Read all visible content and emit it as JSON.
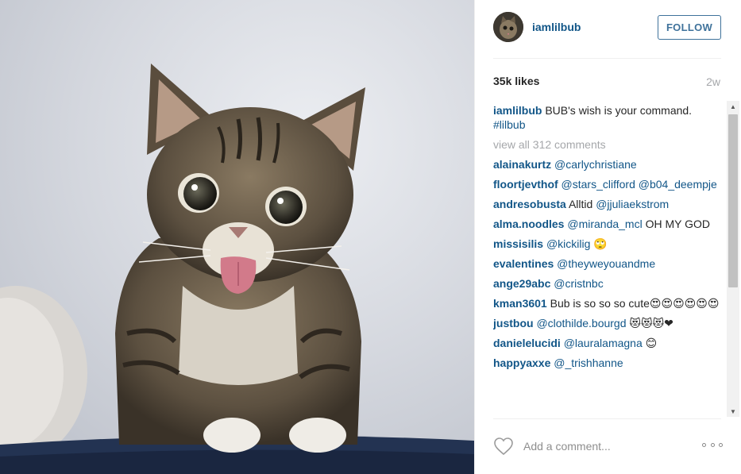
{
  "post": {
    "username": "iamlilbub",
    "follow_label": "FOLLOW",
    "likes": "35k likes",
    "age": "2w"
  },
  "caption": {
    "username": "iamlilbub",
    "text": "BUB's wish is your command.",
    "hashtag": "#lilbub"
  },
  "view_all": "view all 312 comments",
  "comments": [
    {
      "user": "alainakurtz",
      "mention": "@carlychristiane",
      "text": ""
    },
    {
      "user": "floortjevthof",
      "mention": "@stars_clifford @b04_deempje",
      "text": ""
    },
    {
      "user": "andresobusta",
      "text": "Alltid",
      "mention": "@jjuliaekstrom"
    },
    {
      "user": "alma.noodles",
      "mention": "@miranda_mcl",
      "text": "OH MY GOD"
    },
    {
      "user": "missisilis",
      "mention": "@kickilig",
      "text": "🙄"
    },
    {
      "user": "evalentines",
      "mention": "@theyweyouandme",
      "text": ""
    },
    {
      "user": "ange29abc",
      "mention": "@cristnbc",
      "text": ""
    },
    {
      "user": "kman3601",
      "text": "Bub is so so so cute😍😍😍😍😍😍",
      "mention": ""
    },
    {
      "user": "justbou",
      "mention": "@clothilde.bourgd",
      "text": "😻😻😻❤"
    },
    {
      "user": "danielelucidi",
      "mention": "@lauralamagna",
      "text": "😊"
    },
    {
      "user": "happyaxxe",
      "mention": "@_trishhanne",
      "text": ""
    }
  ],
  "footer": {
    "comment_placeholder": "Add a comment..."
  },
  "icons": {
    "heart": "heart-icon",
    "more": "more-options-icon",
    "scroll_up": "▲",
    "scroll_down": "▼"
  },
  "colors": {
    "link": "#125688",
    "follow": "#3f729b",
    "muted": "#a5a7aa"
  }
}
